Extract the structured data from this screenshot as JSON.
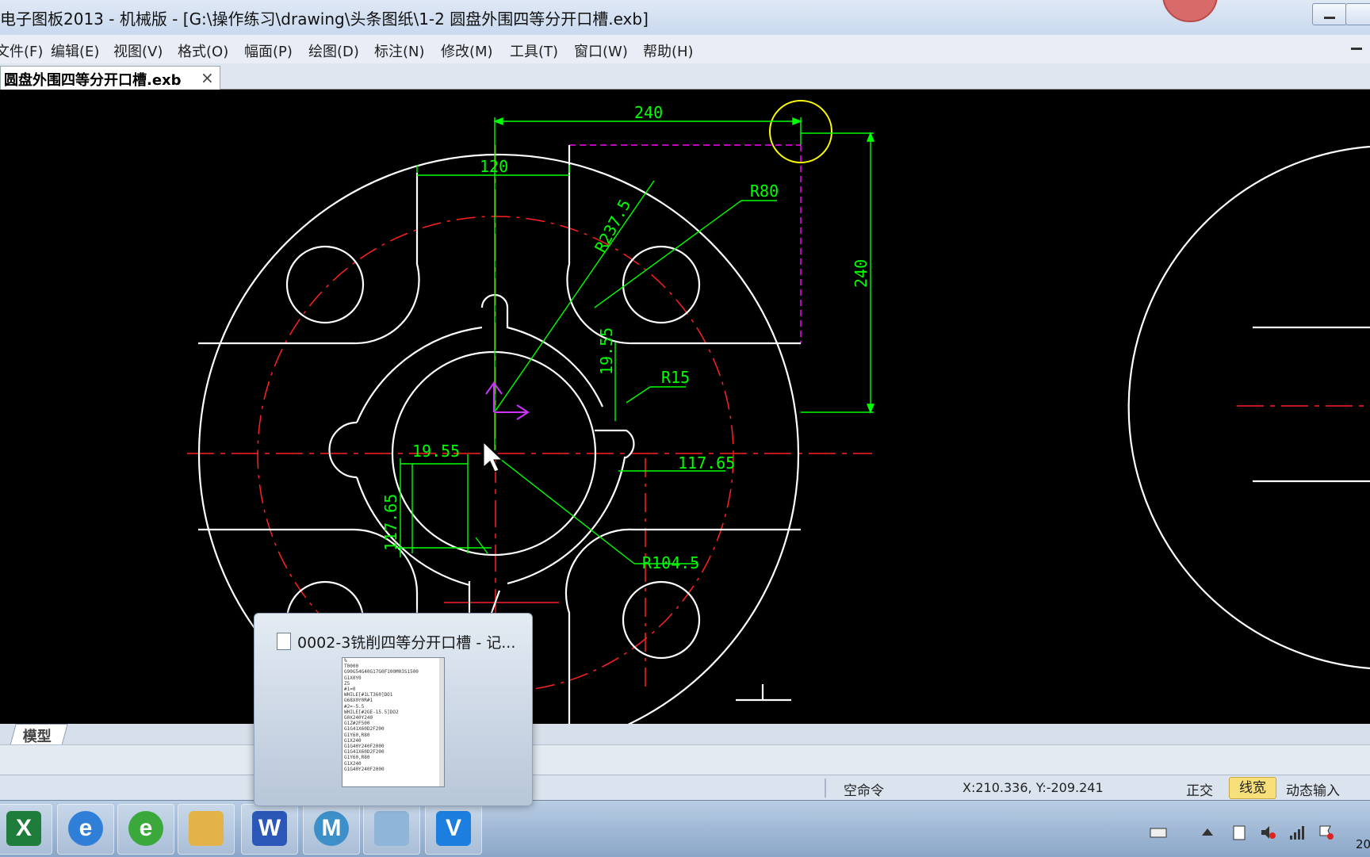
{
  "window": {
    "title": "电子图板2013 - 机械版 - [G:\\操作练习\\drawing\\头条图纸\\1-2 圆盘外围四等分开口槽.exb]"
  },
  "menu": {
    "items": [
      "文件(F)",
      "编辑(E)",
      "视图(V)",
      "格式(O)",
      "幅面(P)",
      "绘图(D)",
      "标注(N)",
      "修改(M)",
      "工具(T)",
      "窗口(W)",
      "帮助(H)"
    ]
  },
  "document_tab": {
    "label": "圆盘外围四等分开口槽.exb",
    "close": "×"
  },
  "drawing": {
    "dims": {
      "top_width": "240",
      "slot_width": "120",
      "radius_80": "R80",
      "radius_237": "R237.5",
      "side_height": "240",
      "small_19": "19.55",
      "radius_15": "R15",
      "left_19": "19.55",
      "right_117": "117.65",
      "vert_117": "117.65",
      "radius_104": "R104.5"
    },
    "colors": {
      "outline": "#ffffff",
      "dimension": "#00ff00",
      "centerline": "#ff0000",
      "hidden": "#ff00ff",
      "highlight": "#ffff00",
      "axis": "#cc33ff"
    }
  },
  "model_tab": {
    "label": "模型"
  },
  "status": {
    "command": "空命令",
    "coords": "X:210.336, Y:-209.241",
    "ortho": "正交",
    "line_width": "线宽",
    "dynamic_input": "动态输入"
  },
  "taskbar_preview": {
    "title": "0002-3铣削四等分开口槽 - 记...",
    "thumb_lines": [
      "%",
      "T0000",
      "G90G54G40G17G0F100M03S1500",
      "G1X0Y0",
      "Z5",
      "#1=0",
      "WHILE[#1LT360]DO1",
      "G68X0Y0R#1",
      "#2=-5.5",
      "WHILE[#2GE-15.5]DO2",
      "G0X240Y240",
      "G1Z#2F500",
      "G1G41X60D2F200",
      "G1Y60,R80",
      "G1X240",
      "G1G40Y240F2000",
      "",
      "G1G41X60D2F200",
      "G1Y60,R80",
      "G1X240",
      "G1G40Y240F2000"
    ]
  },
  "taskbar": {
    "apps": [
      "excel-icon",
      "ie-icon",
      "ie-green-icon",
      "explorer-icon",
      "word-icon",
      "caxa-icon",
      "notepad-icon",
      "v-app-icon"
    ],
    "clock": "20"
  }
}
